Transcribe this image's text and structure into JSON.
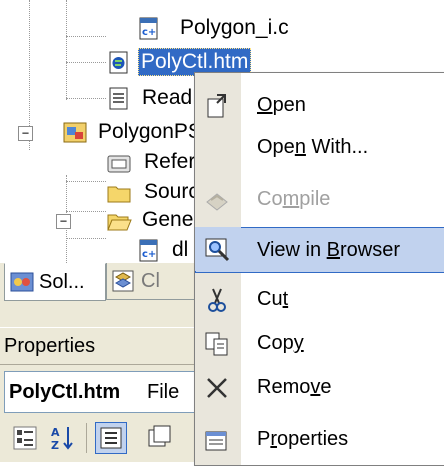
{
  "tree": {
    "polygon_ic": "Polygon_i.c",
    "polyctl_htm": "PolyCtl.htm",
    "readme": "ReadM",
    "polygonps": "PolygonPS",
    "references": "Refer",
    "source": "Sourc",
    "generated": "Gener",
    "dll": "dl"
  },
  "tabs": {
    "solution_label": "Sol...",
    "class_label": "Cl"
  },
  "properties": {
    "header": "Properties",
    "object_name": "PolyCtl.htm",
    "object_type": "File"
  },
  "context_menu": {
    "items": [
      {
        "label": "Open",
        "mnemonic": "O",
        "icon": "open-icon",
        "enabled": true
      },
      {
        "label": "Open With...",
        "mnemonic": "n",
        "icon": "none",
        "enabled": true
      },
      {
        "label": "Compile",
        "mnemonic": "m",
        "icon": "compile-icon",
        "enabled": false
      },
      {
        "label": "View in Browser",
        "mnemonic": "B",
        "icon": "view-in-browser-icon",
        "enabled": true,
        "highlighted": true
      },
      {
        "label": "Cut",
        "mnemonic": "t",
        "icon": "cut-icon",
        "enabled": true
      },
      {
        "label": "Copy",
        "mnemonic": "y",
        "icon": "copy-icon",
        "enabled": true
      },
      {
        "label": "Remove",
        "mnemonic": "v",
        "icon": "remove-icon",
        "enabled": true
      },
      {
        "label": "Properties",
        "mnemonic": "r",
        "icon": "properties-icon",
        "enabled": true
      }
    ]
  },
  "colors": {
    "selection": "#316ac5",
    "menu_highlight": "#c1d2ee",
    "menu_gutter": "#e9e6dc",
    "panel": "#ece9d8"
  }
}
